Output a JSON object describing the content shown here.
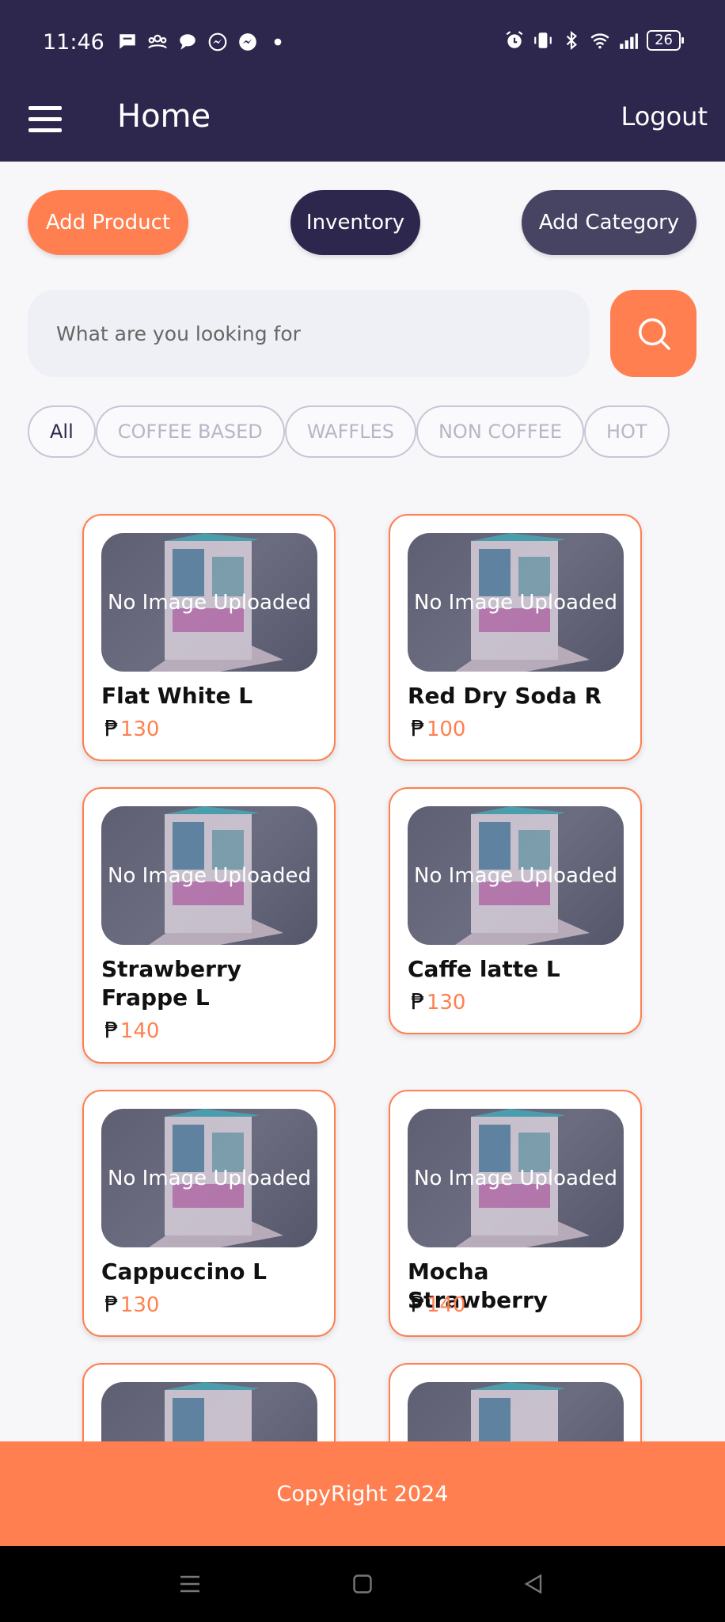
{
  "status_bar": {
    "time": "11:46",
    "battery": "26",
    "left_icons": [
      "chat-icon",
      "group-icon",
      "message-icon",
      "messenger-icon",
      "messenger-icon",
      "dot-icon"
    ],
    "right_icons": [
      "alarm-icon",
      "vibrate-icon",
      "bluetooth-icon",
      "wifi-icon",
      "signal-icon",
      "battery-icon"
    ]
  },
  "appbar": {
    "title": "Home",
    "logout_label": "Logout",
    "menu_icon": "hamburger-icon"
  },
  "actions": {
    "add_product": "Add Product",
    "inventory": "Inventory",
    "add_category": "Add Category"
  },
  "search": {
    "placeholder": "What are you looking for",
    "value": "",
    "icon": "search-icon"
  },
  "categories": [
    "All",
    "COFFEE BASED",
    "WAFFLES",
    "NON COFFEE",
    "HOT"
  ],
  "products": [
    {
      "name": "Flat White L",
      "currency": "₱",
      "price": "130",
      "image_text": "No Image Uploaded"
    },
    {
      "name": "Red Dry Soda R",
      "currency": "₱",
      "price": "100",
      "image_text": "No Image Uploaded"
    },
    {
      "name": "Strawberry Frappe L",
      "currency": "₱",
      "price": "140",
      "image_text": "No Image Uploaded"
    },
    {
      "name": "Caffe latte L",
      "currency": "₱",
      "price": "130",
      "image_text": "No Image Uploaded"
    },
    {
      "name": "Cappuccino L",
      "currency": "₱",
      "price": "130",
      "image_text": "No Image Uploaded"
    },
    {
      "name": "Mocha Strawberry",
      "currency": "₱",
      "price": "140",
      "image_text": "No Image Uploaded"
    },
    {
      "name": "",
      "currency": "",
      "price": "",
      "image_text": ""
    },
    {
      "name": "",
      "currency": "",
      "price": "",
      "image_text": ""
    }
  ],
  "footer": {
    "text": "CopyRight 2024"
  },
  "colors": {
    "primary_dark": "#2e274d",
    "accent": "#ff7f50",
    "secondary": "#474463"
  },
  "nav_bar": {
    "icons": [
      "recents-icon",
      "home-icon",
      "back-icon"
    ]
  }
}
